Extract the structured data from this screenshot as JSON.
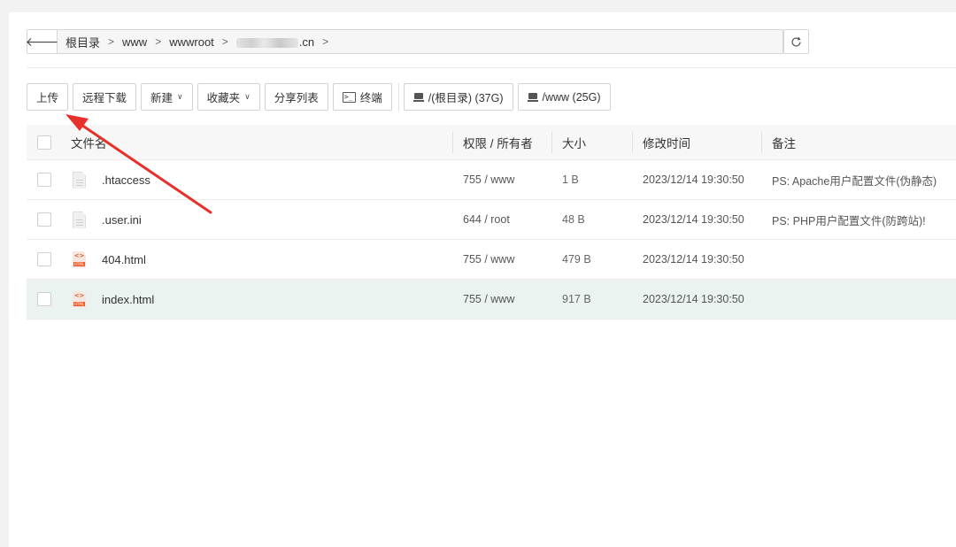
{
  "path_bar": {
    "back_icon": "arrow-left-icon",
    "crumbs": [
      "根目录",
      "www",
      "wwwroot"
    ],
    "masked_crumb_suffix": ".cn",
    "refresh_icon": "refresh-icon"
  },
  "toolbar": {
    "upload": "上传",
    "remote_download": "远程下载",
    "new": "新建",
    "favorites": "收藏夹",
    "share_list": "分享列表",
    "terminal": "终端",
    "disk_root": "/(根目录) (37G)",
    "disk_www": "/www (25G)"
  },
  "table": {
    "headers": {
      "name": "文件名",
      "permission": "权限 / 所有者",
      "size": "大小",
      "modified": "修改时间",
      "note": "备注"
    },
    "rows": [
      {
        "name": ".htaccess",
        "icon": "text-file-icon",
        "permission": "755 / www",
        "size": "1 B",
        "modified": "2023/12/14 19:30:50",
        "note": "PS: Apache用户配置文件(伪静态)"
      },
      {
        "name": ".user.ini",
        "icon": "text-file-icon",
        "permission": "644 / root",
        "size": "48 B",
        "modified": "2023/12/14 19:30:50",
        "note": "PS: PHP用户配置文件(防跨站)!"
      },
      {
        "name": "404.html",
        "icon": "html-file-icon",
        "permission": "755 / www",
        "size": "479 B",
        "modified": "2023/12/14 19:30:50",
        "note": ""
      },
      {
        "name": "index.html",
        "icon": "html-file-icon",
        "permission": "755 / www",
        "size": "917 B",
        "modified": "2023/12/14 19:30:50",
        "note": ""
      }
    ]
  },
  "colors": {
    "annotation_arrow": "#e8302a",
    "selected_row": "#eaf3ef",
    "html_icon": "#f05a28"
  }
}
